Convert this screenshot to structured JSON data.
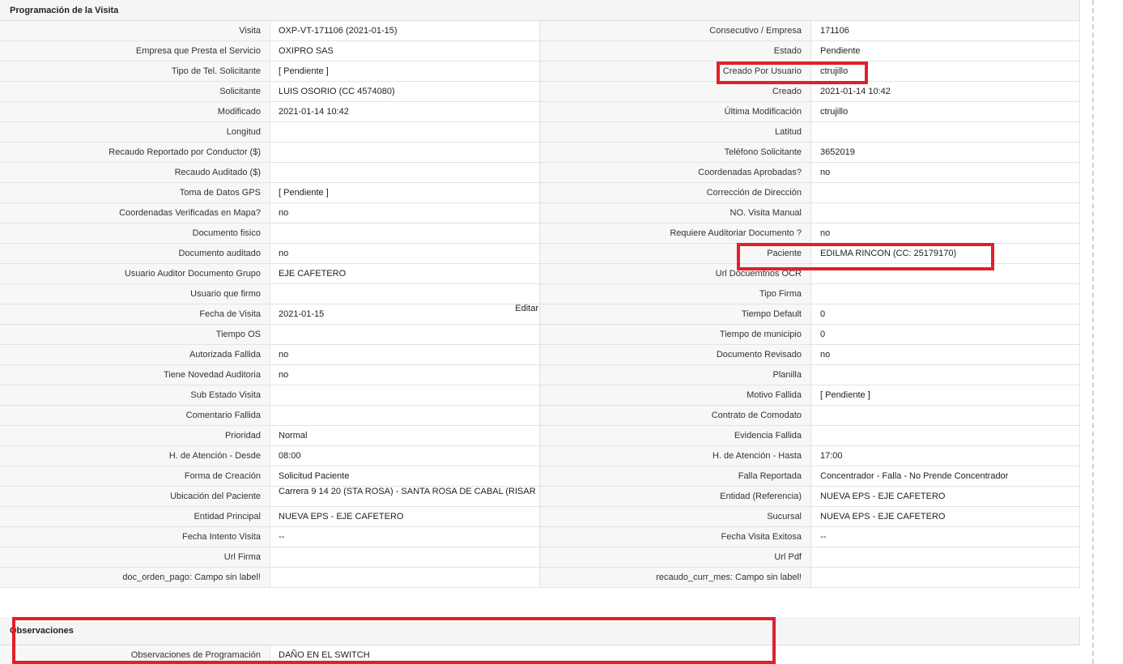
{
  "section1": {
    "title": "Programación de la Visita",
    "edit_label": "Editar",
    "rows": [
      {
        "l1": "Visita",
        "v1": "OXP-VT-171106 (2021-01-15)",
        "l2": "Consecutivo / Empresa",
        "v2": "171106"
      },
      {
        "l1": "Empresa que Presta el Servicio",
        "v1": "OXIPRO SAS",
        "l2": "Estado",
        "v2": "Pendiente"
      },
      {
        "l1": "Tipo de Tel. Solicitante",
        "v1": "[ Pendiente ]",
        "l2": "Creado Por Usuario",
        "v2": "ctrujillo"
      },
      {
        "l1": "Solicitante",
        "v1": "LUIS OSORIO (CC 4574080)",
        "l2": "Creado",
        "v2": "2021-01-14 10:42"
      },
      {
        "l1": "Modificado",
        "v1": "2021-01-14 10:42",
        "l2": "Última Modificación",
        "v2": " ctrujillo"
      },
      {
        "l1": "Longitud",
        "v1": "",
        "l2": "Latitud",
        "v2": ""
      },
      {
        "l1": "Recaudo Reportado por Conductor ($)",
        "v1": "",
        "l2": "Teléfono Solicitante",
        "v2": "3652019"
      },
      {
        "l1": "Recaudo Auditado ($)",
        "v1": "",
        "l2": "Coordenadas Aprobadas?",
        "v2": " no"
      },
      {
        "l1": "Toma de Datos GPS",
        "v1": "[ Pendiente ]",
        "l2": "Corrección de Dirección",
        "v2": ""
      },
      {
        "l1": "Coordenadas Verificadas en Mapa?",
        "v1": " no",
        "l2": "NO. Visita Manual",
        "v2": ""
      },
      {
        "l1": "Documento fisico",
        "v1": "",
        "l2": "Requiere Auditoriar Documento ?",
        "v2": " no"
      },
      {
        "l1": "Documento auditado",
        "v1": " no",
        "l2": "Paciente",
        "v2": "EDILMA RINCON (CC: 25179170)"
      },
      {
        "l1": "Usuario Auditor Documento Grupo",
        "v1": "EJE CAFETERO",
        "l2": "Url Docuemtnos OCR",
        "v2": ""
      },
      {
        "l1": "Usuario que firmo",
        "v1": "",
        "l2": "Tipo Firma",
        "v2": ""
      },
      {
        "l1": "Fecha de Visita",
        "v1": " 2021-01-15",
        "l2": "Tiempo Default",
        "v2": "0"
      },
      {
        "l1": "Tiempo OS",
        "v1": "",
        "l2": "Tiempo de municipio",
        "v2": "0"
      },
      {
        "l1": "Autorizada Fallida",
        "v1": " no",
        "l2": "Documento Revisado",
        "v2": " no"
      },
      {
        "l1": "Tiene Novedad Auditoria",
        "v1": " no",
        "l2": "Planilla",
        "v2": ""
      },
      {
        "l1": "Sub Estado Visita",
        "v1": "",
        "l2": "Motivo Fallida",
        "v2": "[ Pendiente ]"
      },
      {
        "l1": "Comentario Fallida",
        "v1": "",
        "l2": "Contrato de Comodato",
        "v2": ""
      },
      {
        "l1": "Prioridad",
        "v1": "Normal",
        "l2": "Evidencia Fallida",
        "v2": ""
      },
      {
        "l1": "H. de Atención - Desde",
        "v1": "08:00",
        "l2": "H. de Atención - Hasta",
        "v2": "17:00"
      },
      {
        "l1": "Forma de Creación",
        "v1": "Solicitud Paciente",
        "l2": "Falla Reportada",
        "v2": "Concentrador - Falla - No Prende Concentrador"
      },
      {
        "l1": "Ubicación del Paciente",
        "v1": "Carrera 9 14 20 (STA ROSA) - SANTA ROSA DE CABAL (RISAR",
        "l2": "Entidad (Referencia)",
        "v2": "NUEVA EPS - EJE CAFETERO"
      },
      {
        "l1": "Entidad Principal",
        "v1": "NUEVA EPS - EJE CAFETERO",
        "l2": "Sucursal",
        "v2": "NUEVA EPS - EJE CAFETERO"
      },
      {
        "l1": "Fecha Intento Visita",
        "v1": " --",
        "l2": "Fecha Visita Exitosa",
        "v2": " --"
      },
      {
        "l1": "Url Firma",
        "v1": "",
        "l2": "Url Pdf",
        "v2": ""
      },
      {
        "l1": "doc_orden_pago: Campo sin label!",
        "v1": "",
        "l2": "recaudo_curr_mes: Campo sin label!",
        "v2": ""
      }
    ]
  },
  "section2": {
    "title": "Observaciones",
    "rows": [
      {
        "l1": "Observaciones de Programación",
        "v1": " DAÑO EN EL SWITCH"
      }
    ]
  },
  "colors": {
    "highlight": "#e0202a",
    "header_bg": "#f5f5f5",
    "label_bg": "#f7f7f7"
  }
}
